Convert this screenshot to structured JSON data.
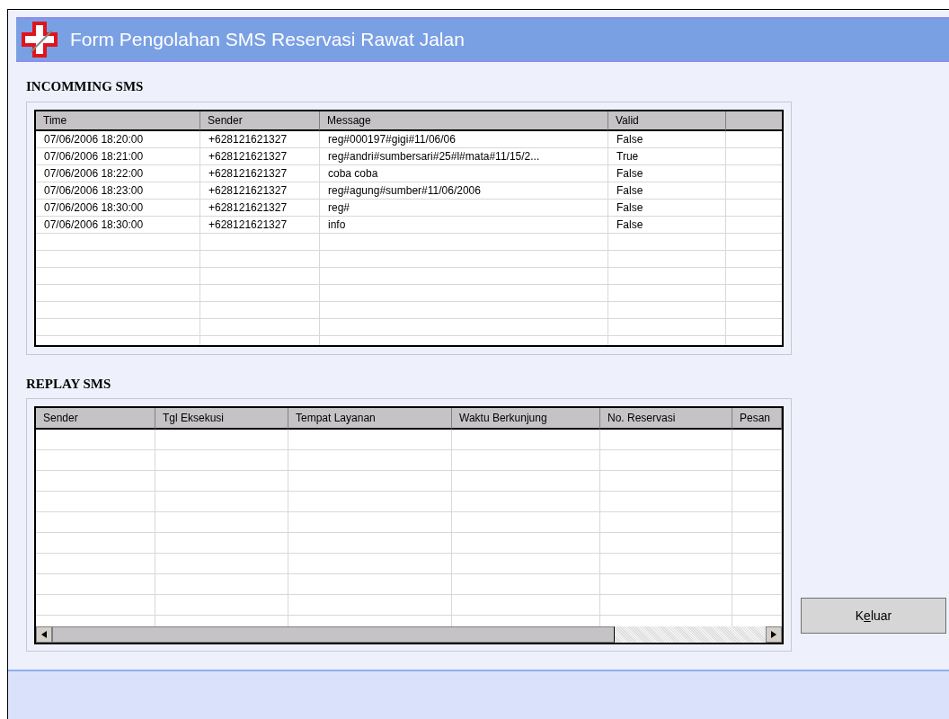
{
  "window": {
    "title": "Form Pengolahan SMS Reservasi Rawat Jalan"
  },
  "incoming": {
    "heading": "INCOMMING SMS",
    "columns": [
      "Time",
      "Sender",
      "Message",
      "Valid"
    ],
    "rows": [
      {
        "time": "07/06/2006 18:20:00",
        "sender": "+628121621327",
        "message": "reg#000197#gigi#11/06/06",
        "valid": "False"
      },
      {
        "time": "07/06/2006 18:21:00",
        "sender": "+628121621327",
        "message": "reg#andri#sumbersari#25#l#mata#11/15/2...",
        "valid": "True"
      },
      {
        "time": "07/06/2006 18:22:00",
        "sender": "+628121621327",
        "message": "coba coba",
        "valid": "False"
      },
      {
        "time": "07/06/2006 18:23:00",
        "sender": "+628121621327",
        "message": "reg#agung#sumber#11/06/2006",
        "valid": "False"
      },
      {
        "time": "07/06/2006 18:30:00",
        "sender": "+628121621327",
        "message": "reg#",
        "valid": "False"
      },
      {
        "time": "07/06/2006 18:30:00",
        "sender": "+628121621327",
        "message": "info",
        "valid": "False"
      }
    ]
  },
  "replay": {
    "heading": "REPLAY SMS",
    "columns": [
      "Sender",
      "Tgl Eksekusi",
      "Tempat Layanan",
      "Waktu Berkunjung",
      "No. Reservasi",
      "Pesan"
    ]
  },
  "exit_button": {
    "label": "Keluar",
    "mnemonic": true
  }
}
